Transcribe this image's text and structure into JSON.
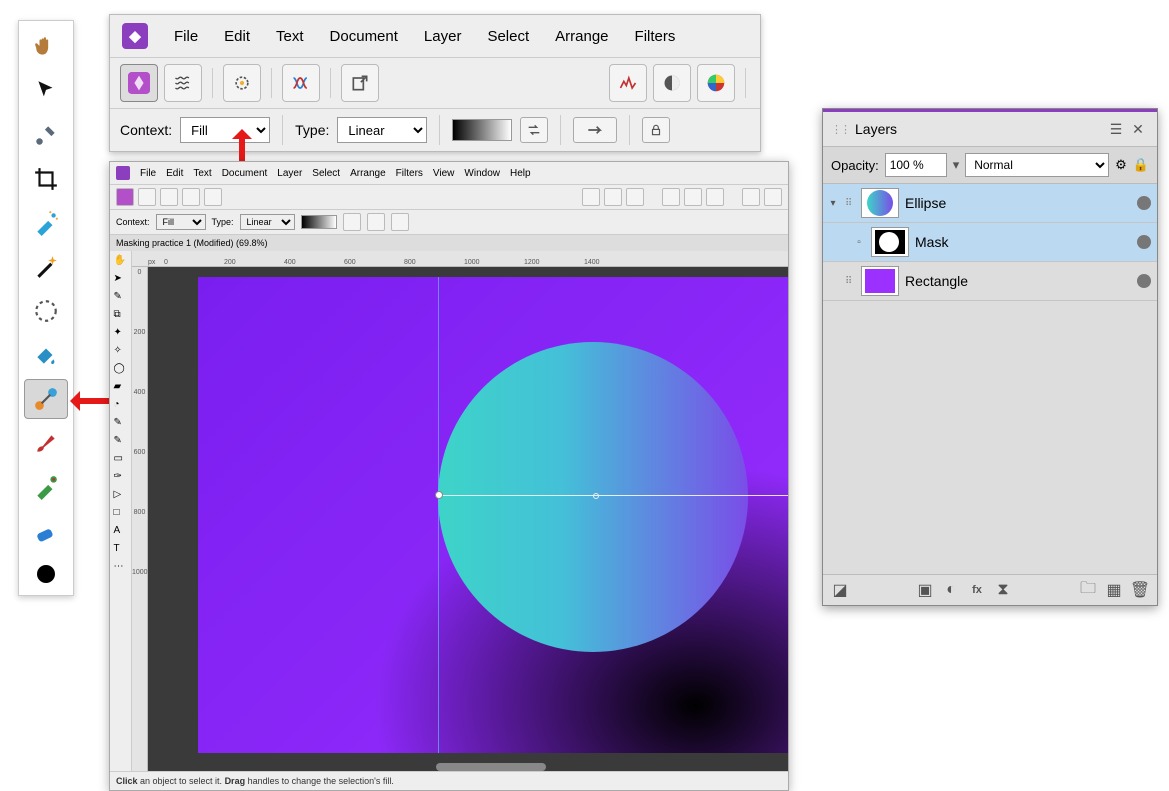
{
  "menu": {
    "items": [
      "File",
      "Edit",
      "Text",
      "Document",
      "Layer",
      "Select",
      "Arrange",
      "Filters"
    ],
    "items_sm": [
      "File",
      "Edit",
      "Text",
      "Document",
      "Layer",
      "Select",
      "Arrange",
      "Filters",
      "View",
      "Window",
      "Help"
    ]
  },
  "context": {
    "label": "Context:",
    "fill_value": "Fill",
    "type_label": "Type:",
    "type_value": "Linear"
  },
  "doc": {
    "tab": "Masking practice 1 (Modified) (69.8%)",
    "status_pre": "Click",
    "status_mid": " an object to select it. ",
    "status_drag": "Drag",
    "status_post": " handles to change the selection's fill.",
    "ruler_unit": "px",
    "ruler_h": [
      "0",
      "200",
      "400",
      "600",
      "800",
      "1000",
      "1200",
      "1400"
    ],
    "ruler_v": [
      "0",
      "200",
      "400",
      "600",
      "800",
      "1000"
    ]
  },
  "layers_panel": {
    "title": "Layers",
    "opacity_label": "Opacity:",
    "opacity_value": "100 %",
    "blend_value": "Normal",
    "rows": [
      {
        "name": "Ellipse",
        "selected": true,
        "child": false
      },
      {
        "name": "Mask",
        "selected": true,
        "child": true
      },
      {
        "name": "Rectangle",
        "selected": false,
        "child": false
      }
    ]
  },
  "tools": [
    "hand",
    "move",
    "eyedropper",
    "crop",
    "heal",
    "magic-wand",
    "marquee",
    "flood-fill",
    "gradient",
    "paint-brush",
    "color-sampler",
    "eraser"
  ]
}
